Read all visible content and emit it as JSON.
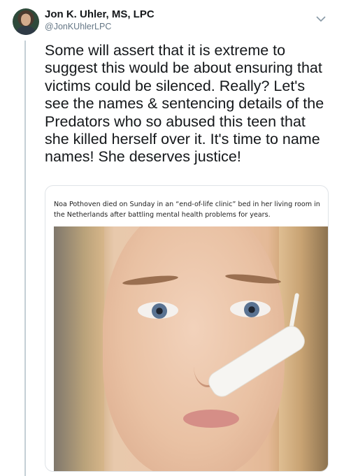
{
  "tweet": {
    "author_name": "Jon K. Uhler, MS, LPC",
    "author_handle": "@JonKUhlerLPC",
    "text": "Some will assert that it is extreme to suggest this would be about ensuring that victims could be silenced. Really? Let's see the names & sentencing details of the Predators who so abused this teen that she killed herself over it. It's time to name names! She deserves justice!"
  },
  "card": {
    "caption": "Noa Pothoven died on Sunday in an “end-of-life clinic” bed in her living room in the Netherlands after battling mental health problems for years."
  },
  "icons": {
    "avatar": "profile-photo",
    "menu": "chevron-down-icon"
  }
}
